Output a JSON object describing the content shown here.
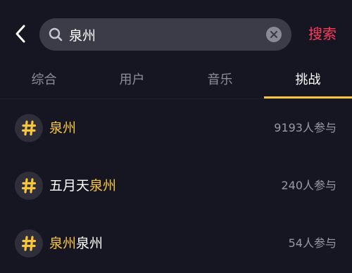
{
  "header": {
    "back_icon": "chevron-left-icon",
    "search_value": "泉州",
    "search_icon": "search-icon",
    "clear_icon": "clear-icon",
    "search_button": "搜索"
  },
  "tabs": [
    {
      "label": "综合",
      "active": false
    },
    {
      "label": "用户",
      "active": false
    },
    {
      "label": "音乐",
      "active": false
    },
    {
      "label": "挑战",
      "active": true
    }
  ],
  "results": [
    {
      "title_pre": "",
      "title_hl": "泉州",
      "title_post": "",
      "count": "9193人参与"
    },
    {
      "title_pre": "五月天",
      "title_hl": "泉州",
      "title_post": "",
      "count": "240人参与"
    },
    {
      "title_pre": "",
      "title_hl": "泉州",
      "title_post": "泉州",
      "count": "54人参与"
    }
  ],
  "colors": {
    "background": "#161622",
    "accent_highlight": "#f8c63b",
    "search_button": "#fe3a5b"
  }
}
